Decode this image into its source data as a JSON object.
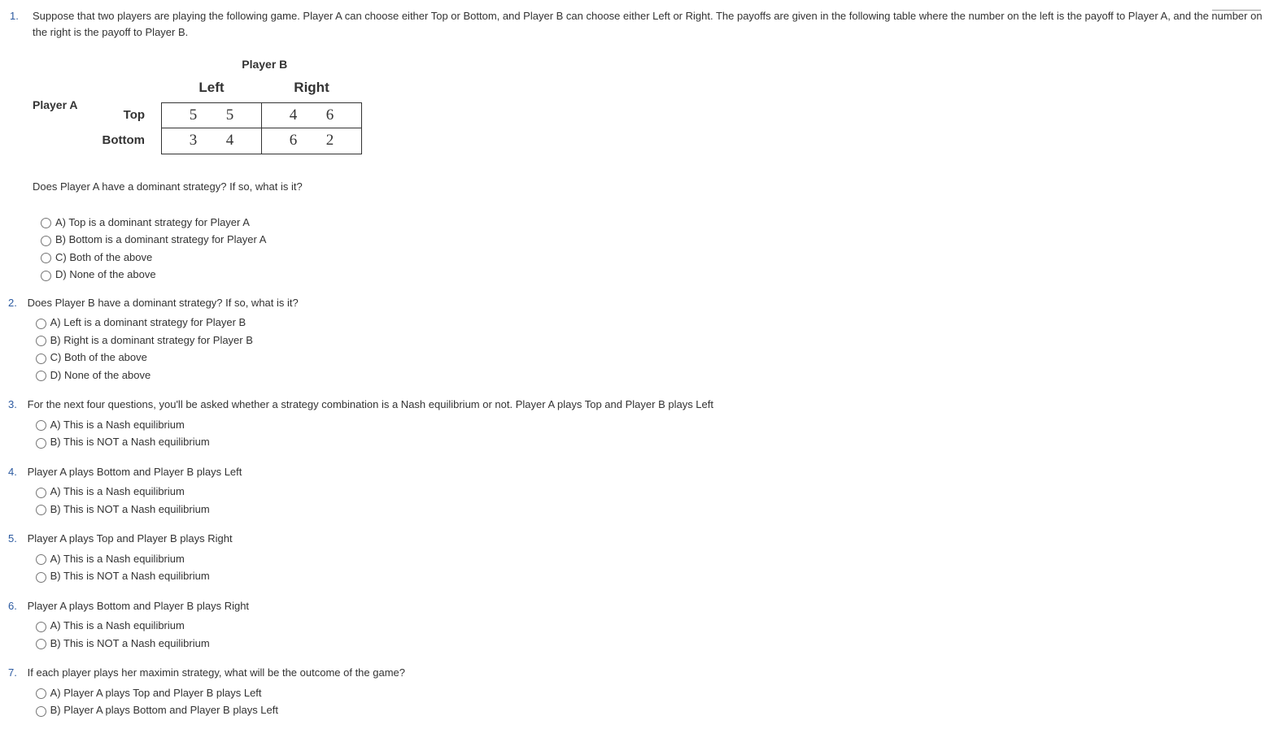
{
  "q1": {
    "number": "1.",
    "intro": "Suppose that two players are playing the following game. Player A can choose either Top or Bottom, and Player B can choose either Left or Right. The payoffs are given in the following table where the number on the left is the payoff to Player A, and the number on the right is the payoff to Player B.",
    "table": {
      "playerA": "Player A",
      "playerB": "Player B",
      "colLeft": "Left",
      "colRight": "Right",
      "rowTop": "Top",
      "rowBottom": "Bottom",
      "cells": {
        "topLeft": {
          "a": "5",
          "b": "5"
        },
        "topRight": {
          "a": "4",
          "b": "6"
        },
        "bottomLeft": {
          "a": "3",
          "b": "4"
        },
        "bottomRight": {
          "a": "6",
          "b": "2"
        }
      }
    },
    "question": "Does Player A have a dominant strategy? If so, what is it?",
    "options": {
      "a": "A) Top is a dominant strategy for Player A",
      "b": "B) Bottom is a dominant strategy for Player A",
      "c": "C) Both of the above",
      "d": "D) None of the above"
    }
  },
  "q2": {
    "number": "2.",
    "question": "Does Player B have a dominant strategy? If so, what is it?",
    "options": {
      "a": "A) Left is a dominant strategy for Player B",
      "b": "B) Right is a dominant strategy for Player B",
      "c": "C) Both of the above",
      "d": "D) None of the above"
    }
  },
  "q3": {
    "number": "3.",
    "question": "For the next four questions, you'll be asked whether a strategy combination is a Nash equilibrium or not. Player A plays Top and Player B plays Left",
    "options": {
      "a": "A) This is a Nash equilibrium",
      "b": "B) This is NOT a Nash equilibrium"
    }
  },
  "q4": {
    "number": "4.",
    "question": "Player A plays Bottom and Player B plays Left",
    "options": {
      "a": "A) This is a Nash equilibrium",
      "b": "B) This is NOT a Nash equilibrium"
    }
  },
  "q5": {
    "number": "5.",
    "question": "Player A plays Top and Player B plays Right",
    "options": {
      "a": "A) This is a Nash equilibrium",
      "b": "B) This is NOT a Nash equilibrium"
    }
  },
  "q6": {
    "number": "6.",
    "question": "Player A plays Bottom and Player B plays Right",
    "options": {
      "a": "A) This is a Nash equilibrium",
      "b": "B) This is NOT a Nash equilibrium"
    }
  },
  "q7": {
    "number": "7.",
    "question": "If each player plays her maximin strategy, what will be the outcome of the game?",
    "options": {
      "a": "A) Player A plays Top and Player B plays Left",
      "b": "B) Player A plays Bottom and Player B plays Left"
    }
  }
}
